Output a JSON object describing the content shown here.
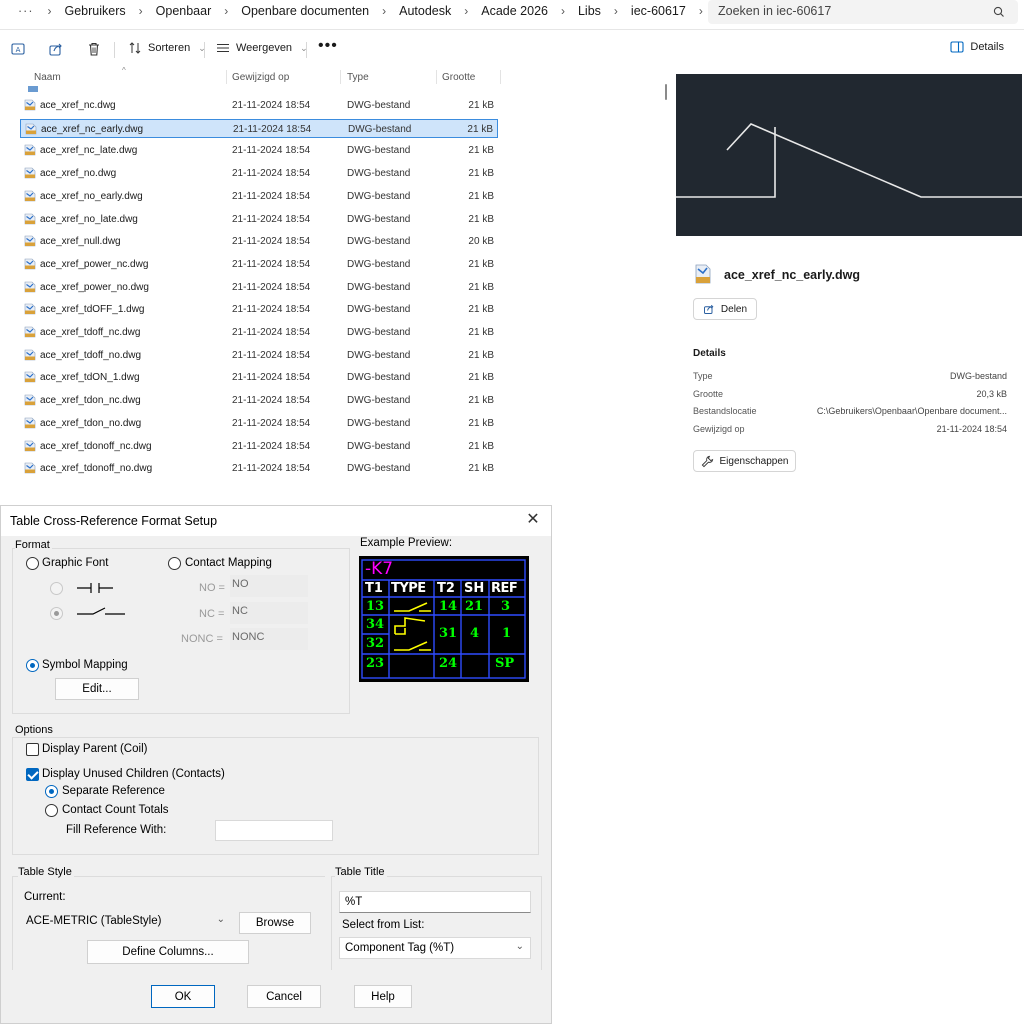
{
  "explorer": {
    "breadcrumb": {
      "more": "···",
      "items": [
        "Gebruikers",
        "Openbaar",
        "Openbare documenten",
        "Autodesk",
        "Acade 2026",
        "Libs",
        "iec-60617"
      ],
      "separator": "›"
    },
    "search": {
      "placeholder": "Zoeken in iec-60617"
    },
    "toolbar": {
      "sort_label": "Sorteren",
      "view_label": "Weergeven",
      "more_label": "•••",
      "details_label": "Details"
    },
    "columns": {
      "name": "Naam",
      "modified": "Gewijzigd op",
      "type": "Type",
      "size": "Grootte"
    },
    "files": [
      {
        "name": "ace_xref_nc.dwg",
        "modified": "21-11-2024 18:54",
        "type": "DWG-bestand",
        "size": "21 kB"
      },
      {
        "name": "ace_xref_nc_early.dwg",
        "modified": "21-11-2024 18:54",
        "type": "DWG-bestand",
        "size": "21 kB",
        "selected": true
      },
      {
        "name": "ace_xref_nc_late.dwg",
        "modified": "21-11-2024 18:54",
        "type": "DWG-bestand",
        "size": "21 kB"
      },
      {
        "name": "ace_xref_no.dwg",
        "modified": "21-11-2024 18:54",
        "type": "DWG-bestand",
        "size": "21 kB"
      },
      {
        "name": "ace_xref_no_early.dwg",
        "modified": "21-11-2024 18:54",
        "type": "DWG-bestand",
        "size": "21 kB"
      },
      {
        "name": "ace_xref_no_late.dwg",
        "modified": "21-11-2024 18:54",
        "type": "DWG-bestand",
        "size": "21 kB"
      },
      {
        "name": "ace_xref_null.dwg",
        "modified": "21-11-2024 18:54",
        "type": "DWG-bestand",
        "size": "20 kB"
      },
      {
        "name": "ace_xref_power_nc.dwg",
        "modified": "21-11-2024 18:54",
        "type": "DWG-bestand",
        "size": "21 kB"
      },
      {
        "name": "ace_xref_power_no.dwg",
        "modified": "21-11-2024 18:54",
        "type": "DWG-bestand",
        "size": "21 kB"
      },
      {
        "name": "ace_xref_tdOFF_1.dwg",
        "modified": "21-11-2024 18:54",
        "type": "DWG-bestand",
        "size": "21 kB"
      },
      {
        "name": "ace_xref_tdoff_nc.dwg",
        "modified": "21-11-2024 18:54",
        "type": "DWG-bestand",
        "size": "21 kB"
      },
      {
        "name": "ace_xref_tdoff_no.dwg",
        "modified": "21-11-2024 18:54",
        "type": "DWG-bestand",
        "size": "21 kB"
      },
      {
        "name": "ace_xref_tdON_1.dwg",
        "modified": "21-11-2024 18:54",
        "type": "DWG-bestand",
        "size": "21 kB"
      },
      {
        "name": "ace_xref_tdon_nc.dwg",
        "modified": "21-11-2024 18:54",
        "type": "DWG-bestand",
        "size": "21 kB"
      },
      {
        "name": "ace_xref_tdon_no.dwg",
        "modified": "21-11-2024 18:54",
        "type": "DWG-bestand",
        "size": "21 kB"
      },
      {
        "name": "ace_xref_tdonoff_nc.dwg",
        "modified": "21-11-2024 18:54",
        "type": "DWG-bestand",
        "size": "21 kB"
      },
      {
        "name": "ace_xref_tdonoff_no.dwg",
        "modified": "21-11-2024 18:54",
        "type": "DWG-bestand",
        "size": "21 kB"
      }
    ],
    "details_pane": {
      "file_title": "ace_xref_nc_early.dwg",
      "share_label": "Delen",
      "heading": "Details",
      "rows": [
        {
          "label": "Type",
          "value": "DWG-bestand"
        },
        {
          "label": "Grootte",
          "value": "20,3 kB"
        },
        {
          "label": "Bestandslocatie",
          "value": "C:\\Gebruikers\\Openbaar\\Openbare document..."
        },
        {
          "label": "Gewijzigd op",
          "value": "21-11-2024 18:54"
        }
      ],
      "properties_label": "Eigenschappen"
    },
    "colors": {
      "accent": "#0067c0",
      "selected_bg": "#cfe4fa",
      "preview_bg": "#212830"
    }
  },
  "dialog": {
    "title": "Table Cross-Reference Format Setup",
    "close": "✕",
    "format": {
      "label": "Format",
      "graphic_font": "Graphic Font",
      "contact_mapping": "Contact Mapping",
      "no_label": "NO =",
      "no_value": "NO",
      "nc_label": "NC =",
      "nc_value": "NC",
      "nonc_label": "NONC =",
      "nonc_value": "NONC",
      "symbol_mapping": "Symbol Mapping",
      "edit_button": "Edit..."
    },
    "example_preview": {
      "label": "Example Preview:",
      "tag": "-K7",
      "headers": [
        "T1",
        "TYPE",
        "T2",
        "SH",
        "REF"
      ],
      "rows": [
        [
          "13",
          "14",
          "21",
          "3"
        ],
        [
          "34",
          "31",
          "4",
          "1"
        ],
        [
          "32"
        ],
        [
          "23",
          "24",
          "",
          "SP"
        ]
      ],
      "colors": {
        "tag": "#ff00ff",
        "header": "#ffffff",
        "value": "#00ff00",
        "grid": "#3050ff",
        "symbol": "#ffff00"
      }
    },
    "options": {
      "label": "Options",
      "display_parent": "Display Parent (Coil)",
      "display_unused": "Display Unused Children (Contacts)",
      "separate_reference": "Separate Reference",
      "contact_count_totals": "Contact Count Totals",
      "fill_reference_with": "Fill Reference With:"
    },
    "table_style": {
      "label": "Table Style",
      "current_label": "Current:",
      "current_value": "ACE-METRIC  (TableStyle)",
      "browse_button": "Browse",
      "define_columns_button": "Define Columns..."
    },
    "table_title": {
      "label": "Table Title",
      "title_value": "%T",
      "select_label": "Select from List:",
      "select_value": "Component Tag (%T)"
    },
    "buttons": {
      "ok": "OK",
      "cancel": "Cancel",
      "help": "Help"
    }
  }
}
